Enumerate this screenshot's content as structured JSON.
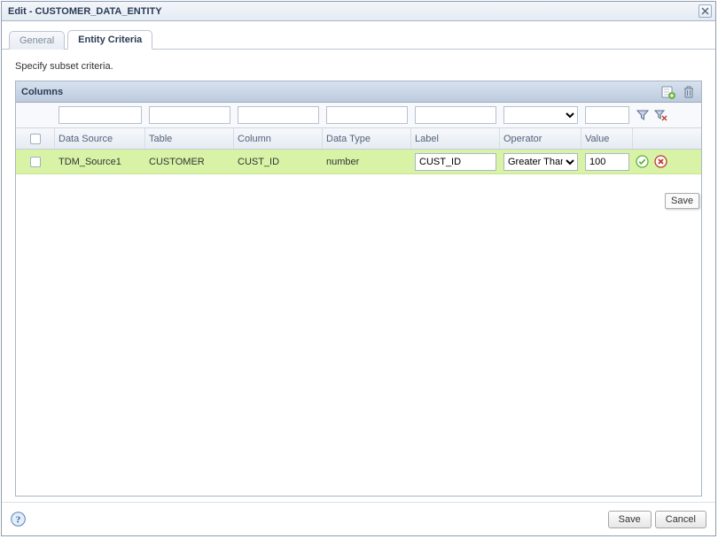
{
  "title": "Edit - CUSTOMER_DATA_ENTITY",
  "tabs": {
    "general": "General",
    "criteria": "Entity Criteria"
  },
  "intro": "Specify subset criteria.",
  "panel": {
    "title": "Columns"
  },
  "columns": {
    "data_source": "Data Source",
    "table": "Table",
    "column": "Column",
    "data_type": "Data Type",
    "label": "Label",
    "operator": "Operator",
    "value": "Value"
  },
  "row": {
    "data_source": "TDM_Source1",
    "table": "CUSTOMER",
    "column": "CUST_ID",
    "data_type": "number",
    "label": "CUST_ID",
    "operator": "Greater Than",
    "value": "100"
  },
  "tooltip": "Save",
  "buttons": {
    "save": "Save",
    "cancel": "Cancel"
  }
}
